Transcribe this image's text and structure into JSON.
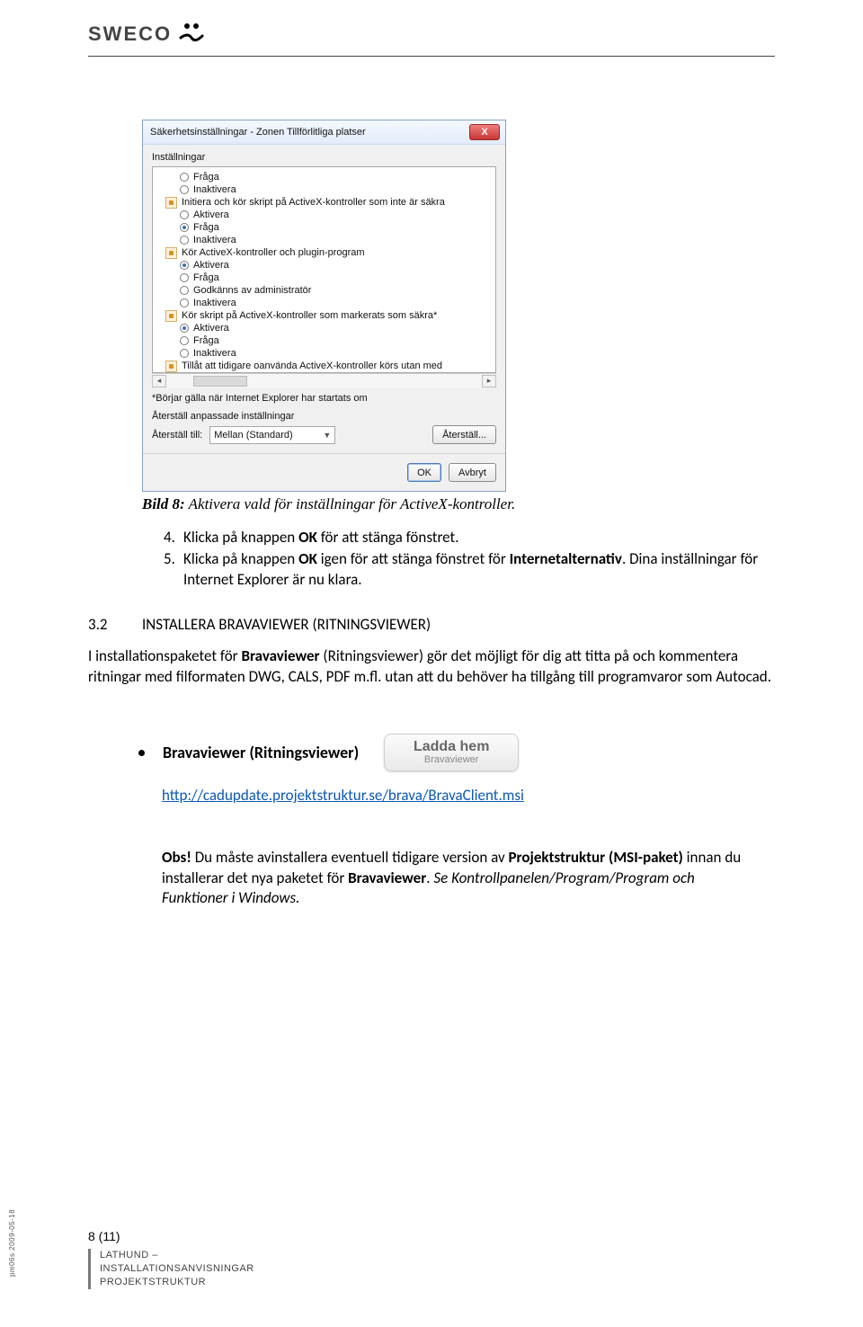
{
  "logo_text": "SWECO",
  "dialog": {
    "title": "Säkerhetsinställningar - Zonen Tillförlitliga platser",
    "group_label": "Inställningar",
    "items": [
      {
        "type": "radio",
        "sel": false,
        "label": "Fråga"
      },
      {
        "type": "radio",
        "sel": false,
        "label": "Inaktivera"
      },
      {
        "type": "section",
        "label": "Initiera och kör skript på ActiveX-kontroller som inte är säkra"
      },
      {
        "type": "radio",
        "sel": false,
        "label": "Aktivera"
      },
      {
        "type": "radio",
        "sel": true,
        "label": "Fråga"
      },
      {
        "type": "radio",
        "sel": false,
        "label": "Inaktivera"
      },
      {
        "type": "section",
        "label": "Kör ActiveX-kontroller och plugin-program"
      },
      {
        "type": "radio",
        "sel": true,
        "label": "Aktivera"
      },
      {
        "type": "radio",
        "sel": false,
        "label": "Fråga"
      },
      {
        "type": "radio",
        "sel": false,
        "label": "Godkänns av administratör"
      },
      {
        "type": "radio",
        "sel": false,
        "label": "Inaktivera"
      },
      {
        "type": "section",
        "label": "Kör skript på ActiveX-kontroller som markerats som säkra*"
      },
      {
        "type": "radio",
        "sel": true,
        "label": "Aktivera"
      },
      {
        "type": "radio",
        "sel": false,
        "label": "Fråga"
      },
      {
        "type": "radio",
        "sel": false,
        "label": "Inaktivera"
      },
      {
        "type": "section",
        "label": "Tillåt att tidigare oanvända ActiveX-kontroller körs utan med"
      }
    ],
    "note": "*Börjar gälla när Internet Explorer har startats om",
    "reset_group": "Återställ anpassade inställningar",
    "reset_label": "Återställ till:",
    "reset_value": "Mellan (Standard)",
    "reset_button": "Återställ...",
    "ok": "OK",
    "cancel": "Avbryt"
  },
  "caption_prefix": "Bild 8:",
  "caption_rest": " Aktivera vald för inställningar för ActiveX-kontroller.",
  "steps": [
    {
      "n": "4.",
      "pre": "Klicka på knappen ",
      "bold": "OK",
      "post": " för att stänga fönstret."
    },
    {
      "n": "5.",
      "pre": "Klicka på knappen ",
      "bold": "OK",
      "post": " igen för att stänga fönstret för ",
      "bold2": "Internetalternativ",
      "post2": ". Dina inställningar för Internet Explorer är nu klara."
    }
  ],
  "section": {
    "num": "3.2",
    "title": "INSTALLERA BRAVAVIEWER (RITNINGSVIEWER)"
  },
  "para_pre": "I installationspaketet för ",
  "para_b1": "Bravaviewer",
  "para_mid": " (Ritningsviewer) gör det möjligt för dig att titta på och kommentera ritningar med filformaten DWG, CALS, PDF  m.fl. utan att du behöver ha tillgång till programvaror som Autocad.",
  "bullet": "Bravaviewer (Ritningsviewer)",
  "download": {
    "line1": "Ladda hem",
    "line2": "Bravaviewer"
  },
  "link": "http://cadupdate.projektstruktur.se/brava/BravaClient.msi",
  "obs_b1": "Obs!",
  "obs_t1": " Du måste avinstallera eventuell tidigare version av ",
  "obs_b2": "Projektstruktur (MSI-paket)",
  "obs_t2": " innan du installerar det nya paketet för ",
  "obs_b3": "Bravaviewer",
  "obs_t3": ". ",
  "obs_i": "Se Kontrollpanelen/Program/Program och Funktioner i Windows.",
  "footer": {
    "page": "8 (11)",
    "l1": "LATHUND –",
    "l2": "INSTALLATIONSANVISNINGAR",
    "l3": "PROJEKTSTRUKTUR"
  },
  "stamp": "pm06s 2009-05-18"
}
